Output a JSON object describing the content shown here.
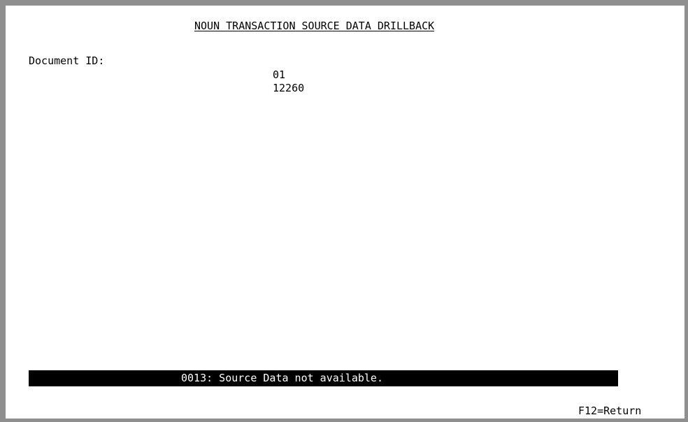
{
  "screen": {
    "title": "NOUN TRANSACTION SOURCE DATA DRILLBACK"
  },
  "document": {
    "label": "Document ID:",
    "values": [
      "01",
      "12260"
    ]
  },
  "message": {
    "text": "0013: Source Data not available."
  },
  "function_keys": {
    "return_label": "F12=Return"
  },
  "colors": {
    "frame": "#8f8f8f",
    "background": "#ffffff",
    "message_bar": "#000000",
    "message_text": "#ffffff"
  }
}
